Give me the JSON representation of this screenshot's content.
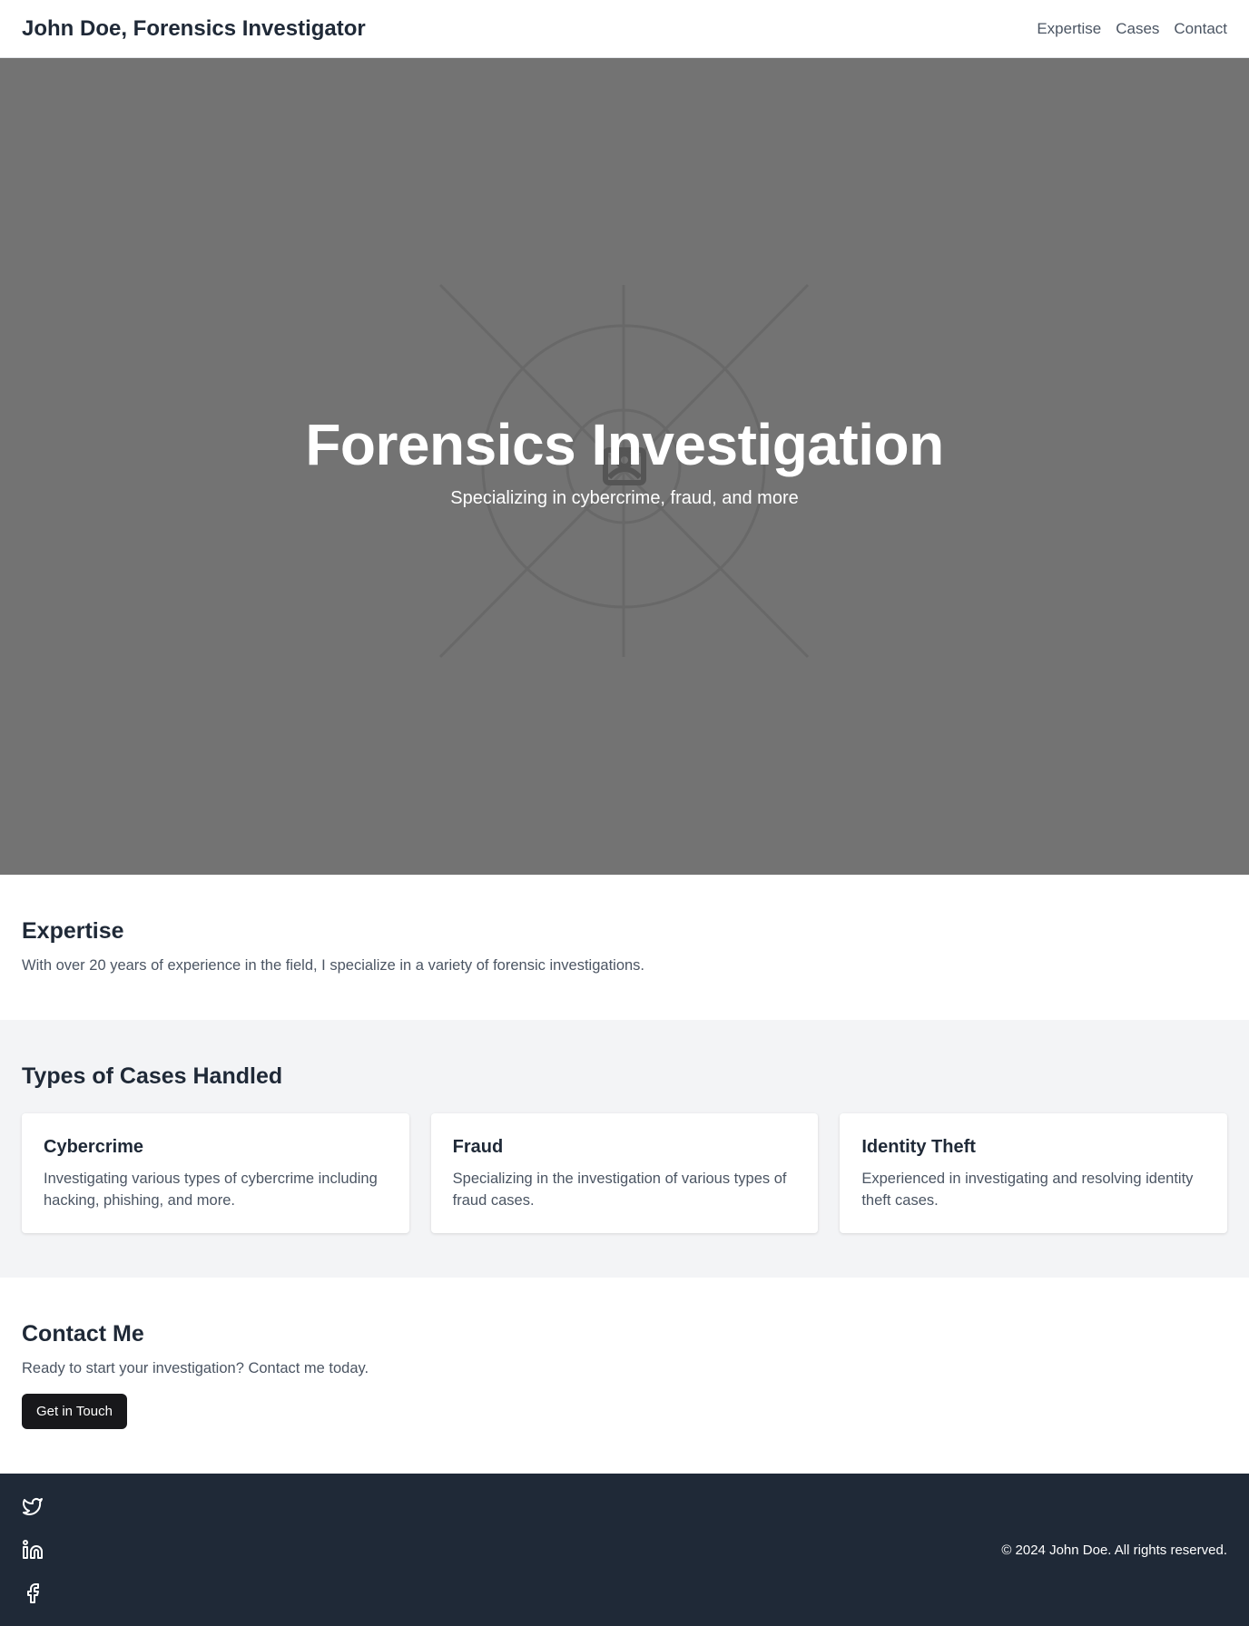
{
  "header": {
    "brand": "John Doe, Forensics Investigator",
    "nav": [
      "Expertise",
      "Cases",
      "Contact"
    ]
  },
  "hero": {
    "title": "Forensics Investigation",
    "subtitle": "Specializing in cybercrime, fraud, and more",
    "image_icon": "image-placeholder-icon"
  },
  "expertise": {
    "heading": "Expertise",
    "text": "With over 20 years of experience in the field, I specialize in a variety of forensic investigations."
  },
  "cases": {
    "heading": "Types of Cases Handled",
    "items": [
      {
        "title": "Cybercrime",
        "text": "Investigating various types of cybercrime including hacking, phishing, and more."
      },
      {
        "title": "Fraud",
        "text": "Specializing in the investigation of various types of fraud cases."
      },
      {
        "title": "Identity Theft",
        "text": "Experienced in investigating and resolving identity theft cases."
      }
    ]
  },
  "contact": {
    "heading": "Contact Me",
    "text": "Ready to start your investigation? Contact me today.",
    "button": "Get in Touch"
  },
  "footer": {
    "social_icons": [
      "twitter-icon",
      "linkedin-icon",
      "facebook-icon"
    ],
    "copyright": "© 2024 John Doe. All rights reserved."
  },
  "colors": {
    "hero_bg": "#737373",
    "footer_bg": "#1f2937",
    "cases_bg": "#f3f4f6",
    "button_bg": "#18181b"
  }
}
